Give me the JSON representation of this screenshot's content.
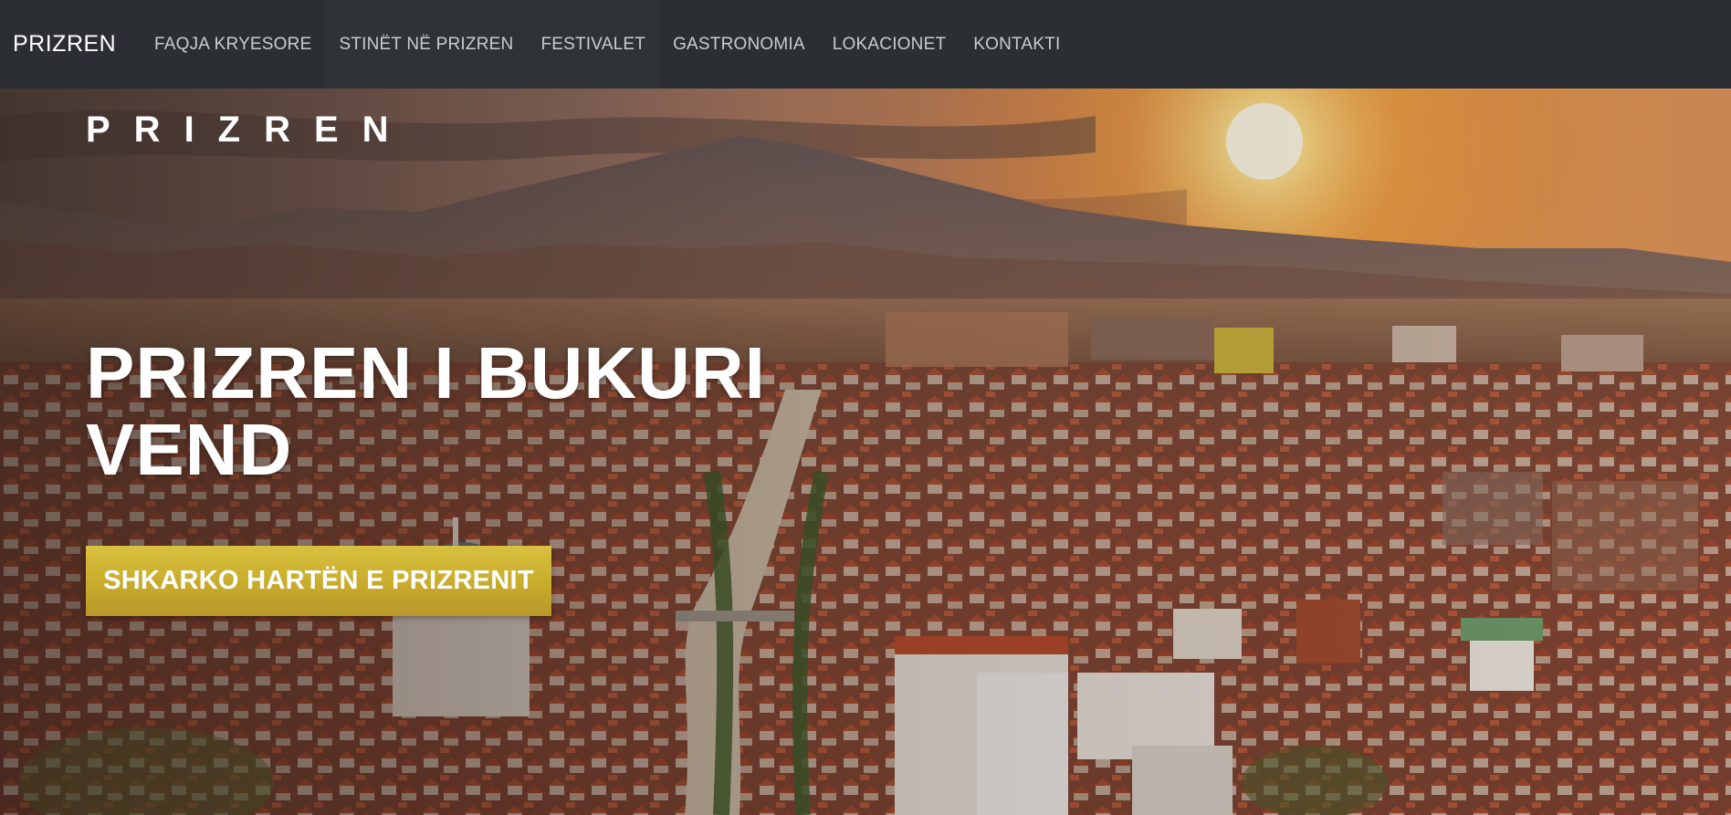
{
  "navbar": {
    "brand": "PRIZREN",
    "items": [
      {
        "label": "FAQJA KRYESORE"
      },
      {
        "label": "STINËT NË PRIZREN"
      },
      {
        "label": "FESTIVALET"
      },
      {
        "label": "GASTRONOMIA"
      },
      {
        "label": "LOKACIONET"
      },
      {
        "label": "KONTAKTI"
      }
    ]
  },
  "hero": {
    "logo_text": "PRIZREN",
    "headline_line1": "PRIZREN I BUKURI",
    "headline_line2": "VEND",
    "cta_label": "SHKARKO HARTËN E PRIZRENIT",
    "colors": {
      "cta_gold": "#c9ab2c",
      "sky_orange": "#e8914a",
      "sun": "#fff4c8",
      "roofs": "#a8482c"
    }
  }
}
